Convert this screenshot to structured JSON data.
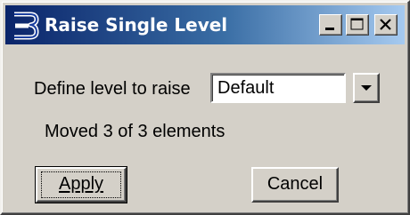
{
  "window": {
    "title": "Raise Single Level",
    "app_icon": "bentley-b-icon",
    "title_gradient": [
      "#0a246a",
      "#a6caf0"
    ],
    "face_color": "#d4d0c8"
  },
  "titlebar_buttons": {
    "minimize_icon": "minimize-icon",
    "maximize_icon": "maximize-icon",
    "close_icon": "close-icon"
  },
  "form": {
    "level_label": "Define level to raise",
    "level_value": "Default",
    "dropdown_icon": "dropdown-arrow-icon"
  },
  "status": {
    "text": "Moved 3 of 3 elements"
  },
  "buttons": {
    "apply_label": "Apply",
    "cancel_label": "Cancel"
  }
}
